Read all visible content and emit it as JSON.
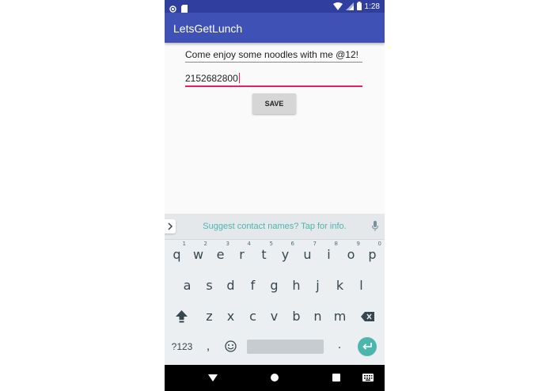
{
  "status_bar": {
    "time": "1:28",
    "icons": [
      "notification-dot-icon",
      "sd-card-icon",
      "wifi-icon",
      "signal-icon",
      "battery-icon"
    ]
  },
  "app_bar": {
    "title": "LetsGetLunch"
  },
  "form": {
    "message_value": "Come enjoy some noodles with me @12!",
    "phone_value": "2152682800",
    "save_label": "SAVE"
  },
  "keyboard": {
    "suggestion": "Suggest contact names? Tap for info.",
    "row1": [
      {
        "label": "q",
        "hint": "1"
      },
      {
        "label": "w",
        "hint": "2"
      },
      {
        "label": "e",
        "hint": "3"
      },
      {
        "label": "r",
        "hint": "4"
      },
      {
        "label": "t",
        "hint": "5"
      },
      {
        "label": "y",
        "hint": "6"
      },
      {
        "label": "u",
        "hint": "7"
      },
      {
        "label": "i",
        "hint": "8"
      },
      {
        "label": "o",
        "hint": "9"
      },
      {
        "label": "p",
        "hint": "0"
      }
    ],
    "row2": [
      "a",
      "s",
      "d",
      "f",
      "g",
      "h",
      "j",
      "k",
      "l"
    ],
    "row3": [
      "z",
      "x",
      "c",
      "v",
      "b",
      "n",
      "m"
    ],
    "symbols_label": "?123",
    "comma_label": ",",
    "period_label": ".",
    "accent_color": "#4db6ac"
  },
  "colors": {
    "primary": "#3f51b5",
    "primary_dark": "#303f9f",
    "focus_accent": "#e91e63"
  }
}
